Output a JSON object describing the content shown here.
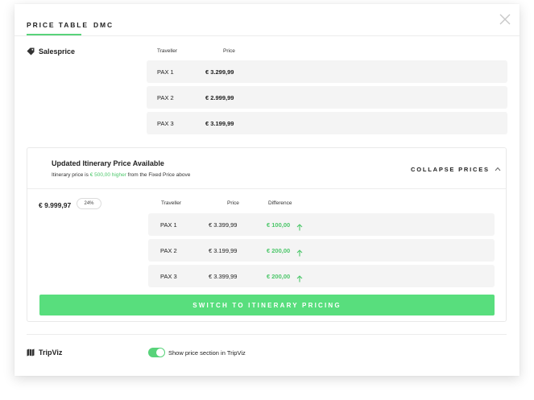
{
  "tabs": [
    {
      "label": "PRICE TABLE",
      "active": true
    },
    {
      "label": "DMC",
      "active": false
    }
  ],
  "icons": {
    "close": "close-icon",
    "salesprice": "tag-icon",
    "tripviz": "map-icon",
    "chevron": "chevron-up-icon",
    "arrow": "arrow-up-icon"
  },
  "salesprice": {
    "label": "Salesprice",
    "headers": {
      "traveller": "Traveller",
      "price": "Price"
    },
    "rows": [
      {
        "pax": "PAX 1",
        "price": "€ 3.299,99"
      },
      {
        "pax": "PAX 2",
        "price": "€ 2.999,99"
      },
      {
        "pax": "PAX 3",
        "price": "€ 3.199,99"
      }
    ]
  },
  "update": {
    "title": "Updated Itinerary Price Available",
    "subtitle_pre": "Itinerary price is ",
    "subtitle_highlight": "€ 500,00 higher",
    "subtitle_post": " from the Fixed Price above",
    "collapse_label": "COLLAPSE PRICES",
    "total": "€ 9.999,97",
    "percent": "24%",
    "headers": {
      "traveller": "Traveller",
      "price": "Price",
      "difference": "Difference"
    },
    "rows": [
      {
        "pax": "PAX 1",
        "price": "€ 3.399,99",
        "difference": "€ 100,00"
      },
      {
        "pax": "PAX 2",
        "price": "€ 3.199,99",
        "difference": "€ 200,00"
      },
      {
        "pax": "PAX 3",
        "price": "€ 3.399,99",
        "difference": "€ 200,00"
      }
    ],
    "switch_label": "SWITCH TO ITINERARY PRICING"
  },
  "tripviz": {
    "label": "TripViz",
    "toggle_on": true,
    "toggle_label": "Show price section in TripViz"
  },
  "colors": {
    "accent": "#58d37a",
    "button": "#58de7d",
    "row_bg": "#f4f4f4"
  }
}
